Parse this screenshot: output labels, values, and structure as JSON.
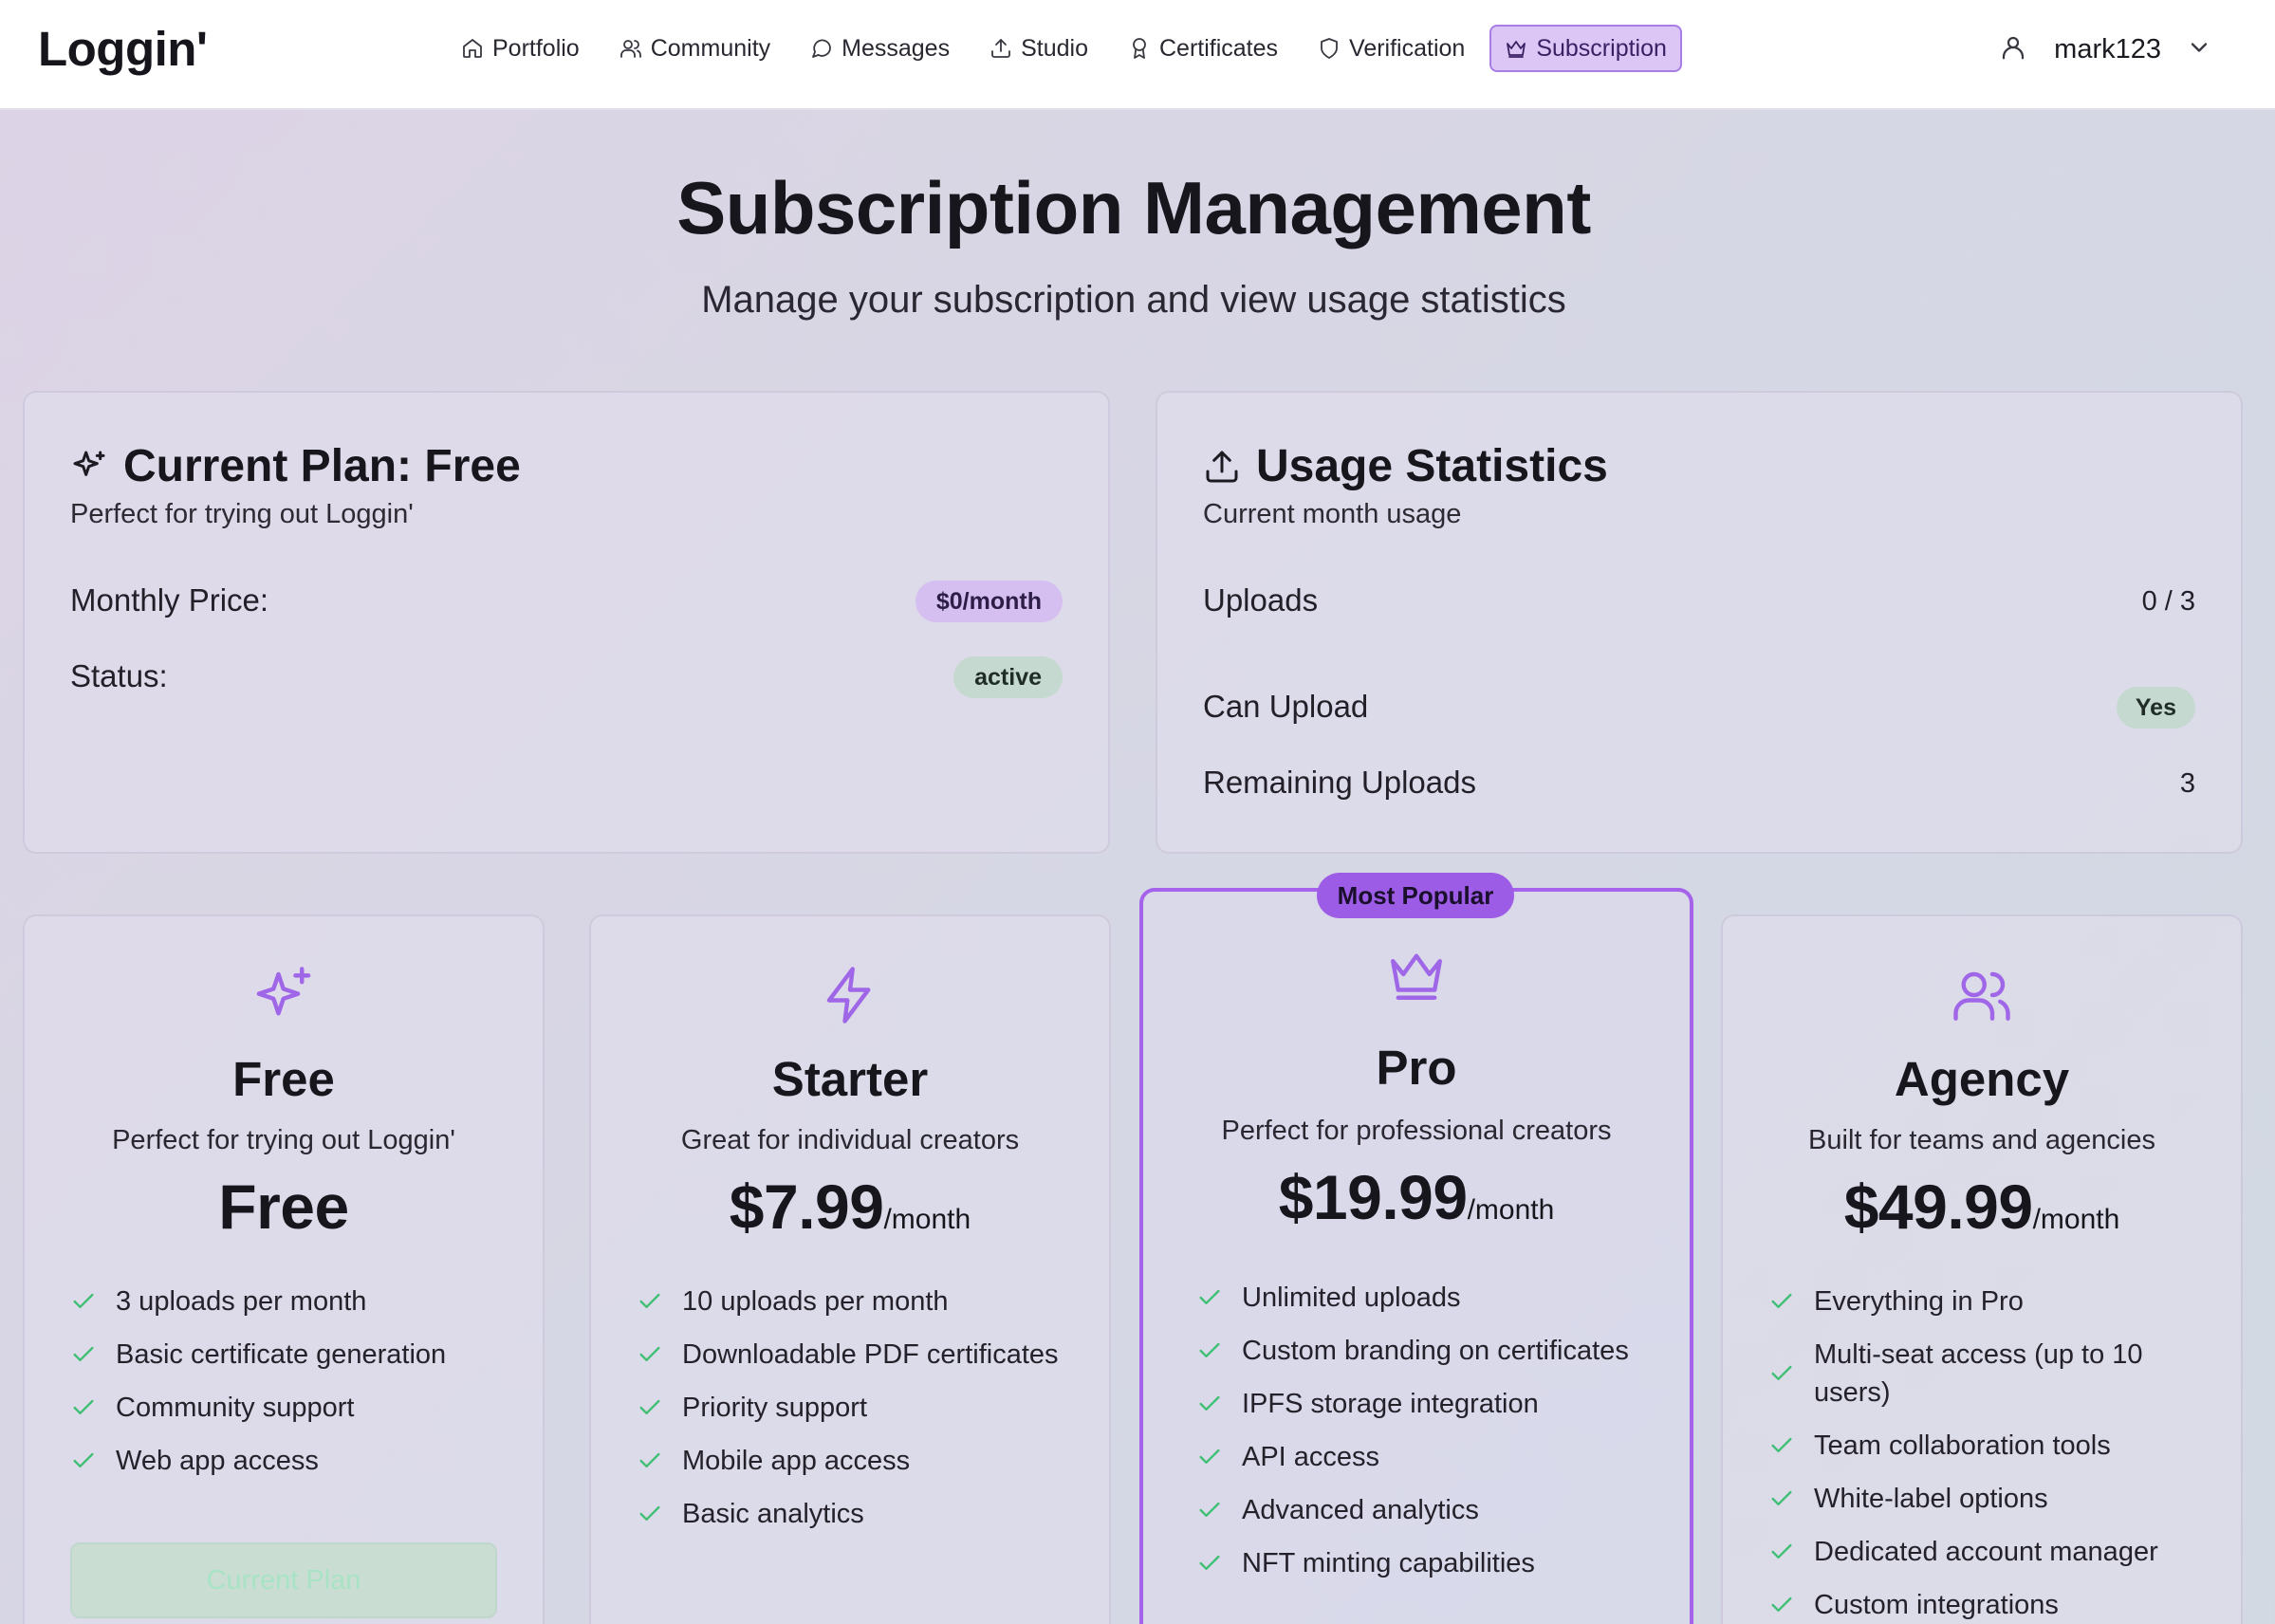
{
  "header": {
    "logo": "Loggin'",
    "nav": [
      {
        "label": "Portfolio",
        "icon": "home-icon"
      },
      {
        "label": "Community",
        "icon": "users-icon"
      },
      {
        "label": "Messages",
        "icon": "message-icon"
      },
      {
        "label": "Studio",
        "icon": "upload-icon"
      },
      {
        "label": "Certificates",
        "icon": "award-icon"
      },
      {
        "label": "Verification",
        "icon": "shield-icon"
      },
      {
        "label": "Subscription",
        "icon": "crown-icon",
        "active": true
      }
    ],
    "username": "mark123"
  },
  "page": {
    "title": "Subscription Management",
    "subtitle": "Manage your subscription and view usage statistics"
  },
  "current_plan": {
    "title": "Current Plan: Free",
    "subtitle": "Perfect for trying out Loggin'",
    "price_label": "Monthly Price:",
    "price_value": "$0/month",
    "status_label": "Status:",
    "status_value": "active"
  },
  "usage": {
    "title": "Usage Statistics",
    "subtitle": "Current month usage",
    "uploads_label": "Uploads",
    "uploads_value": "0 / 3",
    "can_upload_label": "Can Upload",
    "can_upload_value": "Yes",
    "remaining_label": "Remaining Uploads",
    "remaining_value": "3"
  },
  "plans": [
    {
      "name": "Free",
      "icon": "sparkles-icon",
      "description": "Perfect for trying out Loggin'",
      "price": "Free",
      "per": "",
      "features": [
        "3 uploads per month",
        "Basic certificate generation",
        "Community support",
        "Web app access"
      ],
      "button": "Current Plan"
    },
    {
      "name": "Starter",
      "icon": "zap-icon",
      "description": "Great for individual creators",
      "price": "$7.99",
      "per": "/month",
      "features": [
        "10 uploads per month",
        "Downloadable PDF certificates",
        "Priority support",
        "Mobile app access",
        "Basic analytics"
      ]
    },
    {
      "name": "Pro",
      "icon": "crown-icon",
      "badge": "Most Popular",
      "description": "Perfect for professional creators",
      "price": "$19.99",
      "per": "/month",
      "features": [
        "Unlimited uploads",
        "Custom branding on certificates",
        "IPFS storage integration",
        "API access",
        "Advanced analytics",
        "NFT minting capabilities"
      ]
    },
    {
      "name": "Agency",
      "icon": "users-icon",
      "description": "Built for teams and agencies",
      "price": "$49.99",
      "per": "/month",
      "features": [
        "Everything in Pro",
        "Multi-seat access (up to 10 users)",
        "Team collaboration tools",
        "White-label options",
        "Dedicated account manager",
        "Custom integrations"
      ]
    }
  ],
  "colors": {
    "accent": "#a463ea",
    "active_nav_bg": "#dcc6f5",
    "check": "#3fbf73",
    "status_green": "#c5d9d0"
  }
}
